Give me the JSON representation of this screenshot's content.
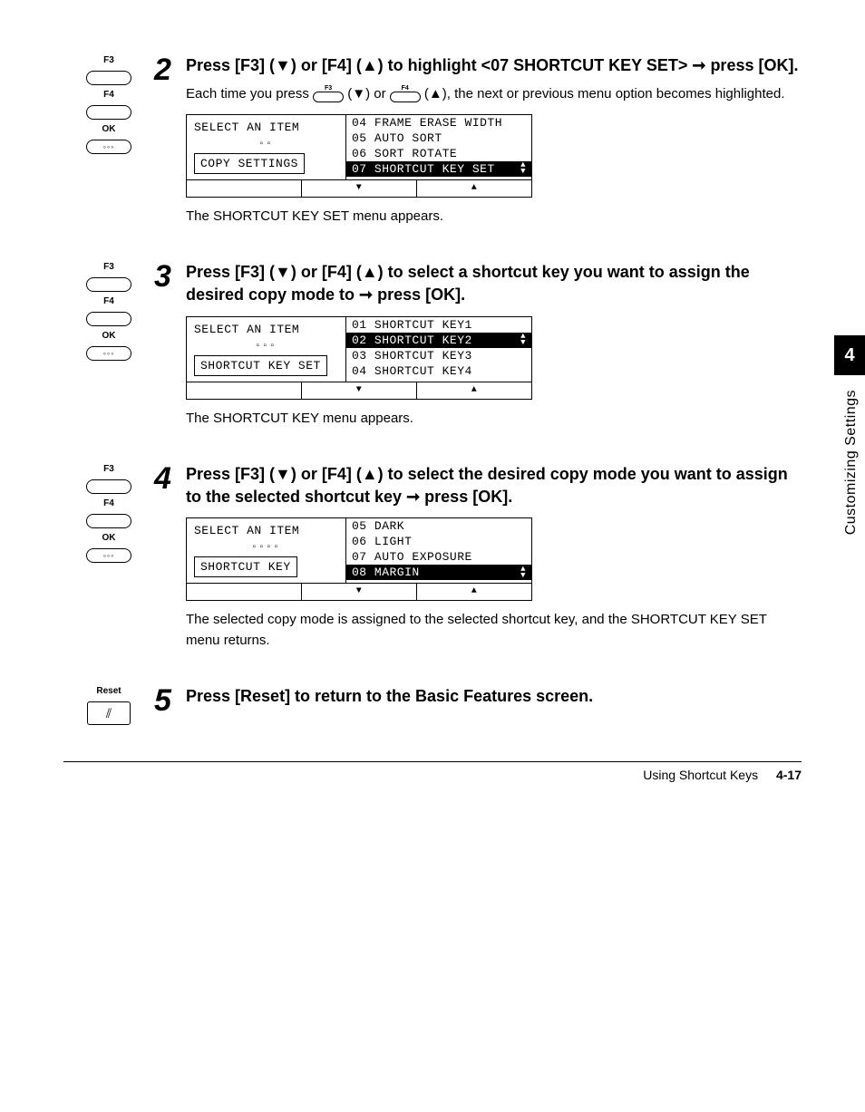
{
  "sideTab": {
    "num": "4",
    "label": "Customizing Settings"
  },
  "footer": {
    "text": "Using Shortcut Keys",
    "page": "4-17"
  },
  "keys": {
    "f3": "F3",
    "f4": "F4",
    "ok": "OK",
    "reset": "Reset"
  },
  "steps": {
    "s2": {
      "num": "2",
      "instr_a": "Press [F3] (▼) or [F4] (▲) to highlight <07 SHORTCUT KEY SET> ",
      "instr_b": " press [OK].",
      "body_a": "Each time you press ",
      "body_b": " (▼) or ",
      "body_c": " (▲), the next or previous menu option becomes highlighted.",
      "after": "The SHORTCUT KEY SET menu appears.",
      "lcd": {
        "title": "SELECT AN ITEM",
        "squares": "▫▫",
        "sub": "COPY SETTINGS",
        "items": [
          "04 FRAME ERASE WIDTH",
          "05 AUTO SORT",
          "06 SORT ROTATE",
          "07 SHORTCUT KEY SET"
        ],
        "selectedIndex": 3
      }
    },
    "s3": {
      "num": "3",
      "instr_a": "Press [F3] (▼) or [F4] (▲) to select a shortcut key you want to assign the desired copy mode to ",
      "instr_b": " press [OK].",
      "after": "The SHORTCUT KEY menu appears.",
      "lcd": {
        "title": "SELECT AN ITEM",
        "squares": "▫▫▫",
        "sub": "SHORTCUT KEY SET",
        "items": [
          "01 SHORTCUT KEY1",
          "02 SHORTCUT KEY2",
          "03 SHORTCUT KEY3",
          "04 SHORTCUT KEY4"
        ],
        "selectedIndex": 1
      }
    },
    "s4": {
      "num": "4",
      "instr_a": "Press [F3] (▼) or [F4] (▲) to select the desired copy mode you want to assign to the selected shortcut key ",
      "instr_b": " press [OK].",
      "after": "The selected copy mode is assigned to the selected shortcut key, and the SHORTCUT KEY SET menu returns.",
      "lcd": {
        "title": "SELECT AN ITEM",
        "squares": "▫▫▫▫",
        "sub": "SHORTCUT KEY",
        "items": [
          "05 DARK",
          "06 LIGHT",
          "07 AUTO EXPOSURE",
          "08 MARGIN"
        ],
        "selectedIndex": 3
      }
    },
    "s5": {
      "num": "5",
      "instr": "Press [Reset] to return to the Basic Features screen."
    }
  }
}
